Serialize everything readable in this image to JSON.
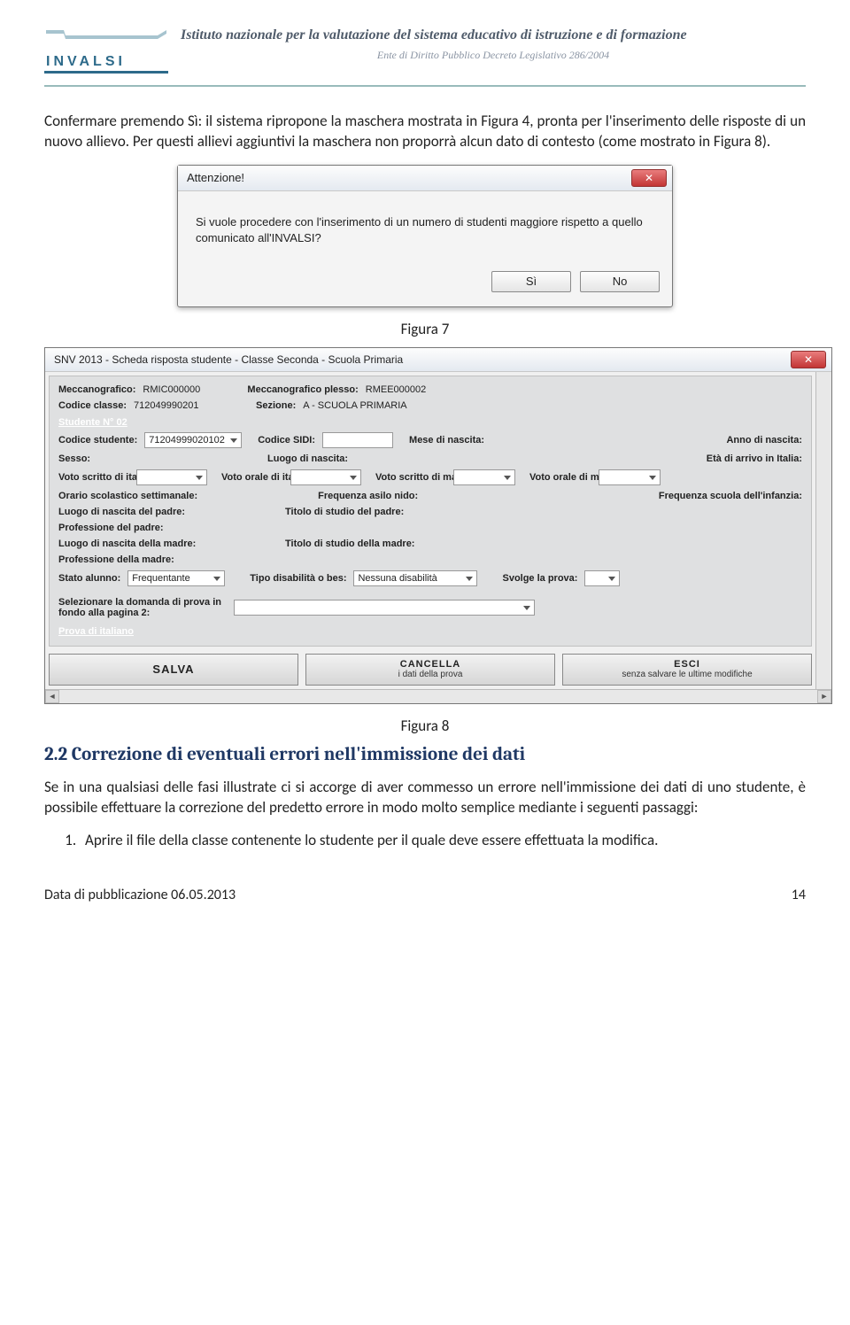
{
  "header": {
    "logo_text": "INVALSI",
    "title": "Istituto nazionale per la valutazione del sistema educativo di istruzione e di formazione",
    "subtitle": "Ente di Diritto Pubblico Decreto Legislativo 286/2004"
  },
  "para1": "Confermare premendo Sì: il sistema ripropone la maschera mostrata in Figura 4, pronta per l'inserimento delle risposte di un nuovo allievo. Per questi allievi aggiuntivi la maschera non proporrà alcun dato di contesto (come mostrato in Figura 8).",
  "caption7": "Figura 7",
  "caption8": "Figura 8",
  "section_title": "2.2 Correzione di eventuali errori nell'immissione dei dati",
  "para2": "Se in una qualsiasi delle fasi illustrate ci si accorge di aver commesso un errore nell'immissione dei dati di uno studente, è possibile effettuare la correzione del predetto errore in modo molto semplice mediante i seguenti passaggi:",
  "step1": "Aprire il file della classe contenente lo studente per il quale deve essere effettuata la modifica.",
  "footer_left": "Data di pubblicazione 06.05.2013",
  "footer_right": "14",
  "dlg7": {
    "title": "Attenzione!",
    "message": "Si vuole procedere con l'inserimento di un numero di studenti maggiore rispetto a quello comunicato all'INVALSI?",
    "yes": "Sì",
    "no": "No"
  },
  "frm": {
    "title": "SNV 2013 - Scheda risposta studente - Classe Seconda - Scuola Primaria",
    "labels": {
      "mecc": "Meccanografico:",
      "mecc_val": "RMIC000000",
      "mecc_pl": "Meccanografico plesso:",
      "mecc_pl_val": "RMEE000002",
      "cod_classe": "Codice classe:",
      "cod_classe_val": "712049990201",
      "sezione": "Sezione:",
      "sezione_val": "A  - SCUOLA PRIMARIA",
      "stud_header": "Studente N° 02",
      "cod_stud": "Codice studente:",
      "cod_stud_val": "71204999020102",
      "cod_sidi": "Codice SIDI:",
      "mese": "Mese di nascita:",
      "anno": "Anno di nascita:",
      "sesso": "Sesso:",
      "luogo_n": "Luogo di nascita:",
      "eta_arr": "Età di arrivo in Italia:",
      "voto_si": "Voto scritto di italiano:",
      "voto_oi": "Voto orale di italiano:",
      "voto_sm": "Voto scritto di matematica:",
      "voto_om": "Voto orale di matematica:",
      "orario": "Orario scolastico settimanale:",
      "freq_nido": "Frequenza asilo nido:",
      "freq_inf": "Frequenza scuola dell'infanzia:",
      "luogo_p": "Luogo di nascita del padre:",
      "tit_p": "Titolo di studio del padre:",
      "prof_p": "Professione del padre:",
      "luogo_m": "Luogo di nascita della madre:",
      "tit_m": "Titolo di studio della madre:",
      "prof_m": "Professione della madre:",
      "stato": "Stato alunno:",
      "stato_val": "Frequentante",
      "tipo_dis": "Tipo disabilità o bes:",
      "tipo_dis_val": "Nessuna disabilità",
      "svolge": "Svolge la prova:",
      "sel_dom": "Selezionare la domanda di prova in fondo alla pagina 2:",
      "prova_it": "Prova di italiano"
    },
    "buttons": {
      "salva": "SALVA",
      "cancella1": "CANCELLA",
      "cancella2": "i dati della prova",
      "esci1": "ESCI",
      "esci2": "senza salvare le ultime modifiche"
    }
  }
}
